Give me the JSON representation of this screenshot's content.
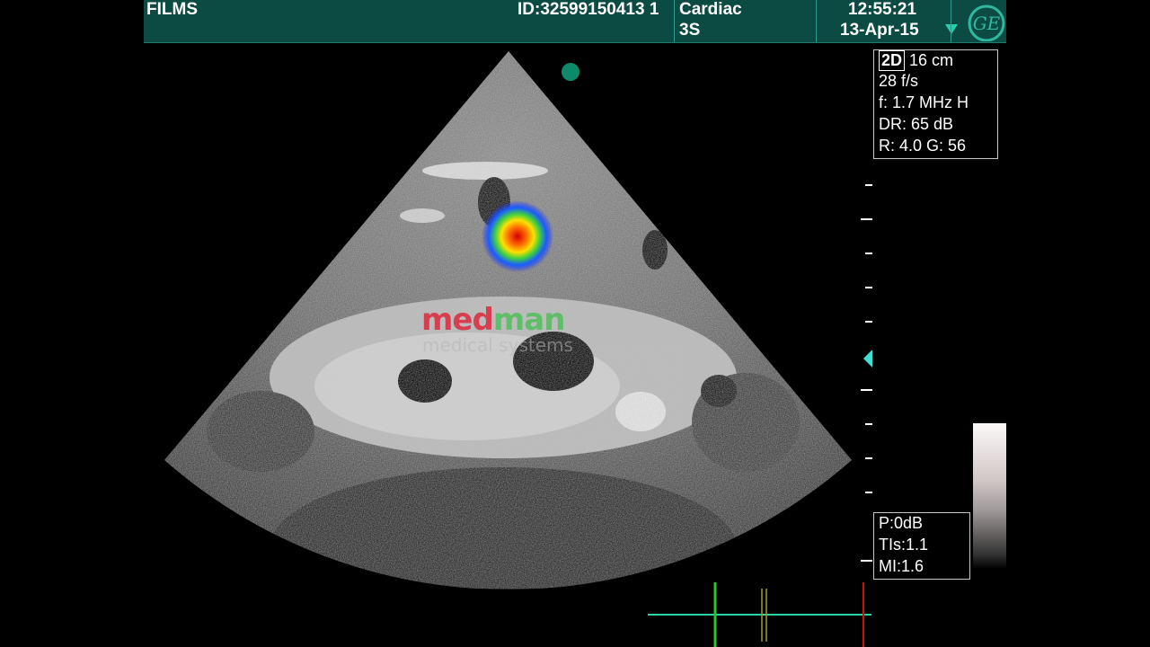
{
  "header": {
    "films_label": "FILMS",
    "patient_id": "ID:32599150413 1",
    "preset": "Cardiac",
    "probe": "3S",
    "time": "12:55:21",
    "date": "13-Apr-15",
    "logo_text": "GE"
  },
  "image_params": {
    "mode": "2D",
    "depth": "16 cm",
    "frame_rate": "28 f/s",
    "frequency": "f: 1.7 MHz H",
    "dynamic_range": "DR: 65 dB",
    "reject_gain": "R: 4.0    G: 56"
  },
  "safety": {
    "power": "P:0dB",
    "tis": "TIs:1.1",
    "mi": "MI:1.6"
  },
  "watermark": {
    "brand_red": "med",
    "brand_green": "man",
    "tagline": "medical systems"
  },
  "colors": {
    "header_bg": "#0c4b43",
    "accent": "#22d0b0",
    "orientation_dot": "#0e8a6a",
    "trace_line": "#2ad2a8",
    "marker_green": "#22cc22",
    "marker_red": "#cc1111"
  }
}
